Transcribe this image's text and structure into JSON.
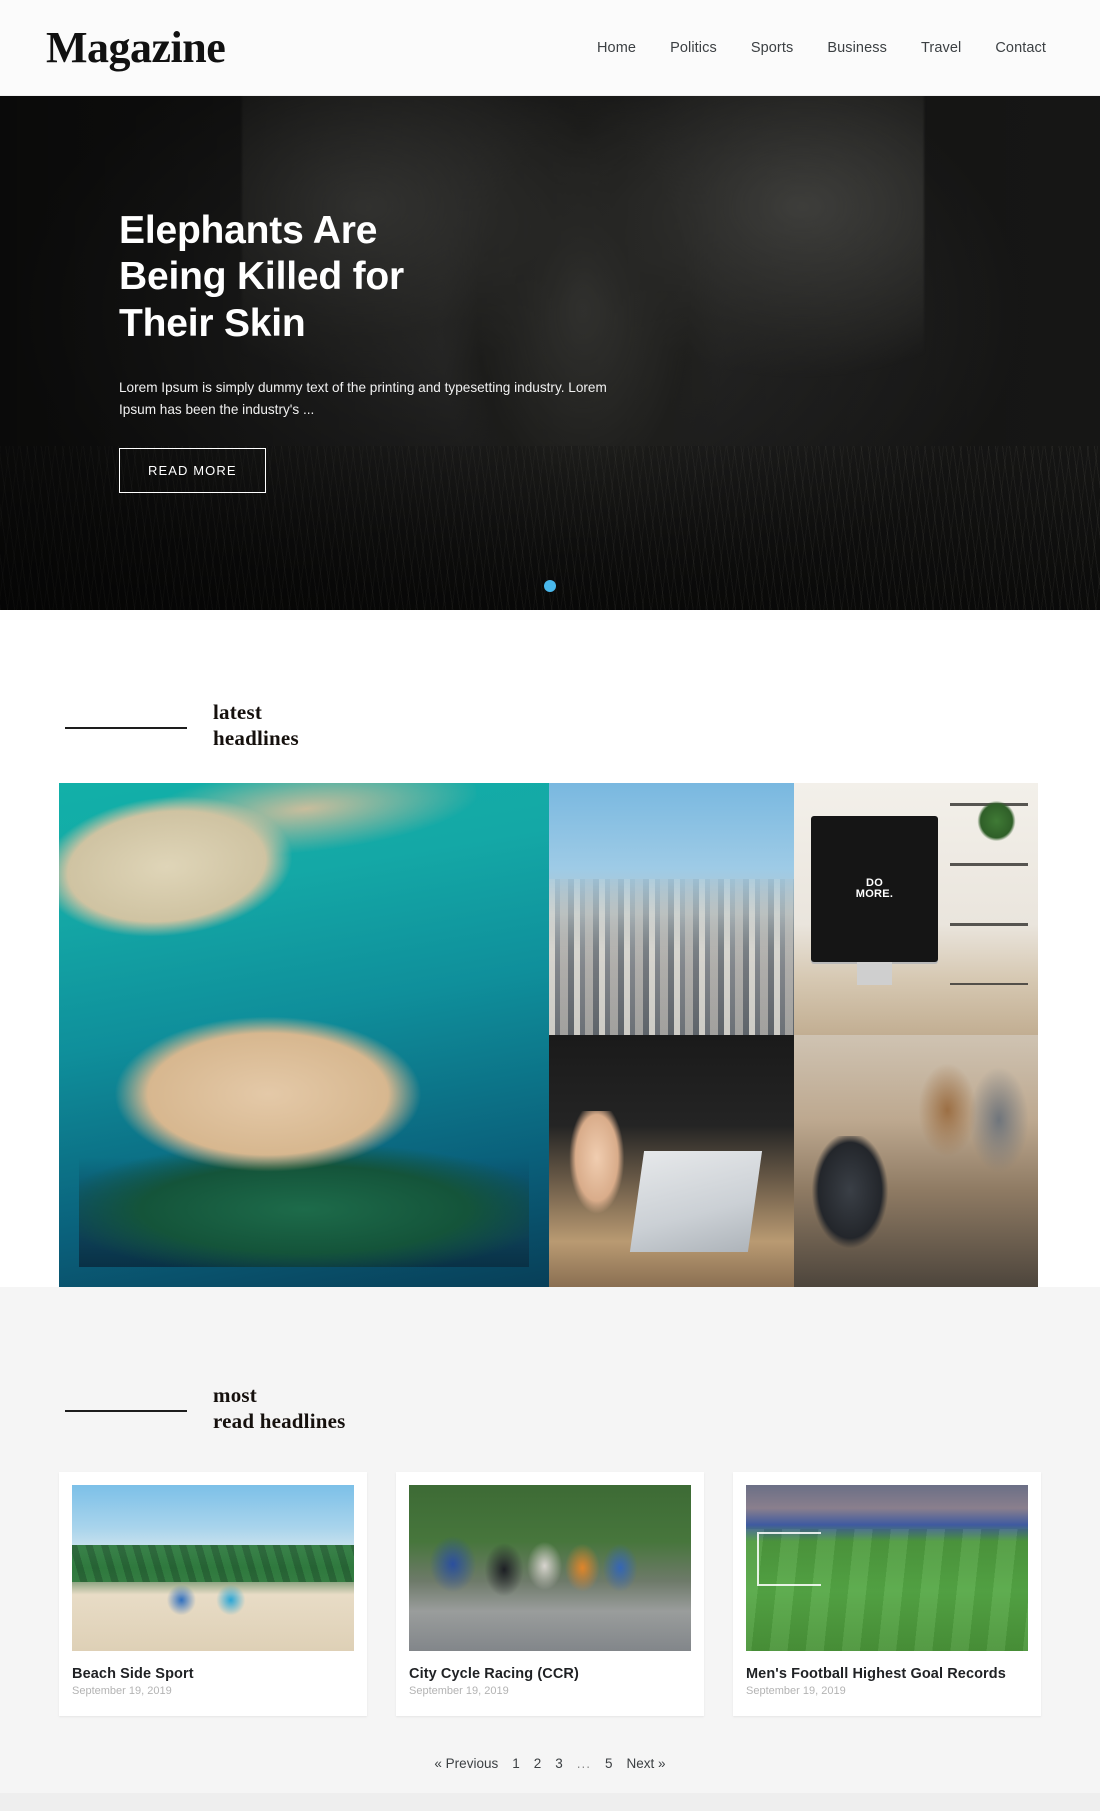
{
  "header": {
    "brand": "Magazine",
    "nav": [
      {
        "label": "Home"
      },
      {
        "label": "Politics"
      },
      {
        "label": "Sports"
      },
      {
        "label": "Business"
      },
      {
        "label": "Travel"
      },
      {
        "label": "Contact"
      }
    ]
  },
  "hero": {
    "title": "Elephants Are Being Killed for Their Skin",
    "subtitle": "Lorem Ipsum is simply dummy text of the printing and typesetting industry. Lorem Ipsum has been the industry's ...",
    "cta_label": "READ MORE",
    "carousel": {
      "slide_count": 1,
      "active_index": 0,
      "active_dot_color": "#49b8ec"
    }
  },
  "latest": {
    "heading_line1": "latest",
    "heading_line2": "headlines",
    "tiles": [
      {
        "name": "aerial-resort-island",
        "art": "art-resort"
      },
      {
        "name": "city-skyline-harbor",
        "art": "art-city"
      },
      {
        "name": "desk-imac-do-more",
        "art": "art-desk",
        "screen_text_line1": "DO",
        "screen_text_line2": "MORE."
      },
      {
        "name": "meeting-hands-laptop",
        "art": "art-meeting"
      },
      {
        "name": "coworking-team-laptops",
        "art": "art-team"
      }
    ]
  },
  "most_read": {
    "heading_line1": "most",
    "heading_line2": "read headlines",
    "cards": [
      {
        "title": "Beach Side Sport",
        "date": "September 19, 2019",
        "art": "art-beach"
      },
      {
        "title": "City Cycle Racing (CCR)",
        "date": "September 19, 2019",
        "art": "art-cycle"
      },
      {
        "title": "Men's Football Highest Goal Records",
        "date": "September 19, 2019",
        "art": "art-football"
      }
    ]
  },
  "pagination": {
    "previous_label": "« Previous",
    "pages": [
      "1",
      "2",
      "3"
    ],
    "ellipsis": "...",
    "last_page": "5",
    "next_label": "Next »"
  }
}
